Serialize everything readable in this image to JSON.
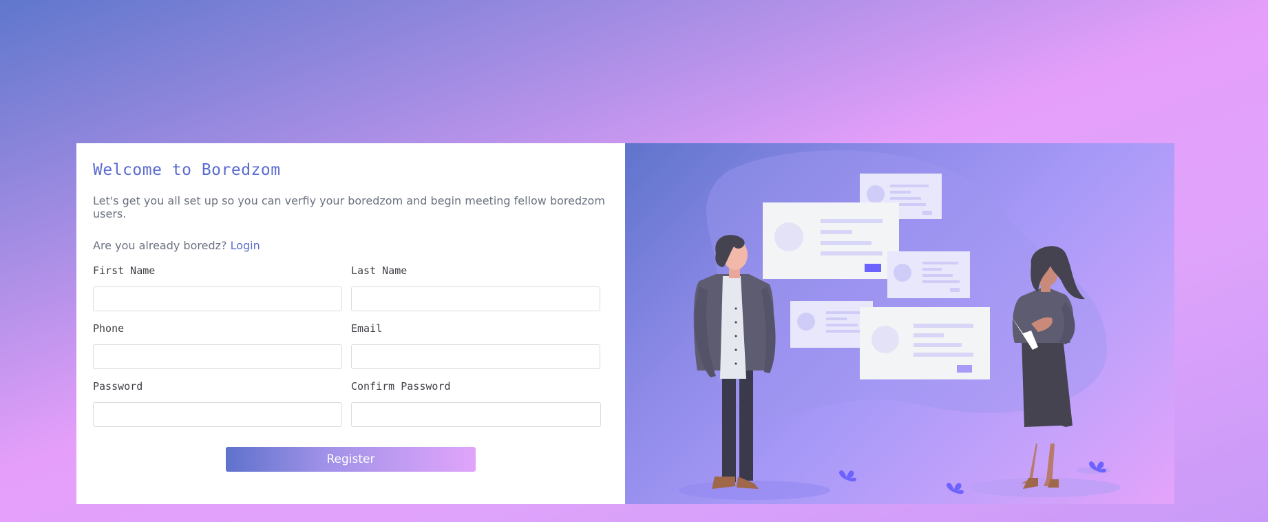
{
  "header": {
    "title": "Welcome to Boredzom",
    "description": "Let's get you all set up so you can verfiy your boredzom and begin meeting fellow boredzom users.",
    "login_prompt": "Are you already boredz?",
    "login_link": "Login"
  },
  "form": {
    "first_name": {
      "label": "First Name",
      "value": ""
    },
    "last_name": {
      "label": "Last Name",
      "value": ""
    },
    "phone": {
      "label": "Phone",
      "value": ""
    },
    "email": {
      "label": "Email",
      "value": ""
    },
    "password": {
      "label": "Password",
      "value": ""
    },
    "confirm_password": {
      "label": "Confirm Password",
      "value": ""
    },
    "submit_label": "Register"
  },
  "colors": {
    "accent": "#5a6bd0",
    "gradient_start": "#5f72cc",
    "gradient_end": "#e0a5fb",
    "card_bg": "#ffffff"
  },
  "illustration": {
    "icon": "people-with-profile-cards-illustration"
  }
}
